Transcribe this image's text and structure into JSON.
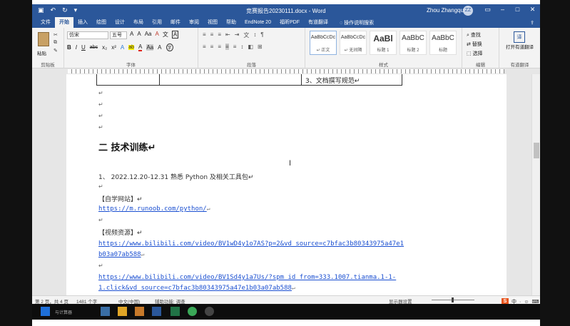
{
  "titlebar": {
    "title": "竞赛报告20230111.docx - Word",
    "user": "Zhou Zhangquan",
    "avatar_initials": "ZZ",
    "quick_access": [
      "save-icon",
      "undo-icon",
      "redo-icon",
      "customize-icon"
    ],
    "window_buttons": [
      "ribbon-display-icon",
      "minimize-icon",
      "maximize-icon",
      "close-icon"
    ]
  },
  "tabs": [
    "文件",
    "开始",
    "插入",
    "绘图",
    "设计",
    "布局",
    "引用",
    "邮件",
    "审阅",
    "视图",
    "帮助",
    "EndNote 20",
    "福昕PDF",
    "有道翻译"
  ],
  "active_tab": "开始",
  "tell_me": "操作说明搜索",
  "share_icon": "share-icon",
  "ribbon": {
    "clipboard": {
      "label": "剪贴板",
      "paste": "粘贴"
    },
    "font": {
      "label": "字体",
      "font_name": "仿宋",
      "font_size": "五号",
      "tools_row1": [
        "A",
        "A",
        "Aa",
        "A",
        "文",
        "A"
      ],
      "tools_row2": [
        "B",
        "I",
        "U",
        "abc",
        "x₂",
        "x²",
        "A",
        "ab",
        "A",
        "Aa",
        "A",
        "字"
      ]
    },
    "paragraph": {
      "label": "段落",
      "row1": [
        "≡",
        "≡",
        "≡",
        "⇤",
        "⇥",
        "文",
        "↕",
        "¶"
      ],
      "row2": [
        "≡",
        "≡",
        "≡",
        "≡",
        "≡",
        "↕",
        "◧",
        "⊞"
      ]
    },
    "styles": {
      "label": "样式",
      "items": [
        {
          "sample": "AaBbCcDc",
          "name": "↵ 正文"
        },
        {
          "sample": "AaBbCcDc",
          "name": "↵ 无间隔"
        },
        {
          "sample": "AaBl",
          "name": "标题 1"
        },
        {
          "sample": "AaBbC",
          "name": "标题 2"
        },
        {
          "sample": "AaBbC",
          "name": "标题"
        }
      ]
    },
    "editing": {
      "label": "编辑",
      "items": [
        "查找",
        "替换",
        "选择"
      ]
    },
    "youdao": {
      "label": "有道翻译",
      "icon": "译",
      "button": "打开有道翻译"
    }
  },
  "document": {
    "table_cell_text": "3、文档撰写规范↵",
    "para_mark": "↵",
    "heading": "二  技术训练↵",
    "item1": "1、 2022.12.20-12.31 熟悉 Python 及相关工具包↵",
    "self_study_label": "【自学网站】↵",
    "link1": "https://m.runoob.com/python/",
    "video_label": "【视频资源】↵",
    "link2_line1": "https://www.bilibili.com/video/BV1wD4y1o7AS?p=2&vd_source=c7bfac3b80343975a47e1",
    "link2_line2": "b03a07ab588",
    "link3_line1": "https://www.bilibili.com/video/BV1Sd4y1a7Us/?spm_id_from=333.1007.tianma.1-1-",
    "link3_line2": "1.click&vd_source=c7bfac3b80343975a47e1b03a07ab588"
  },
  "statusbar": {
    "page": "第 2 页，共 4 页",
    "words": "1481 个字",
    "lang": "中文(中国)",
    "accessibility": "辅助功能: 调查",
    "display": "显示器设置"
  },
  "ime": {
    "logo": "S",
    "items": [
      "中",
      "·",
      "☺",
      "⌨",
      "☰"
    ]
  },
  "taskbar": {
    "label": "与计算器"
  },
  "colors": {
    "word_blue": "#2b579a",
    "link_blue": "#1a4fd1",
    "ime_orange": "#e8551d"
  }
}
